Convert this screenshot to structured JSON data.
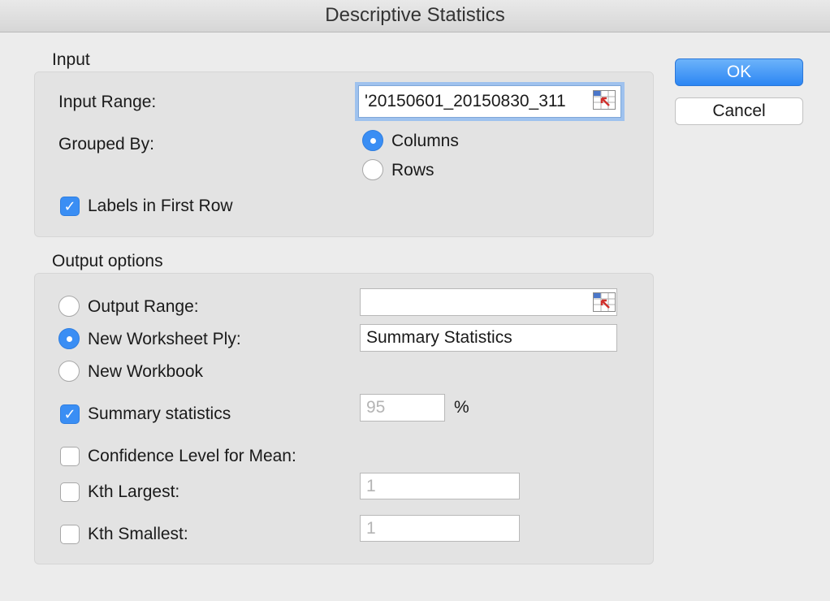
{
  "window": {
    "title": "Descriptive Statistics"
  },
  "buttons": {
    "ok": "OK",
    "cancel": "Cancel"
  },
  "input": {
    "section_label": "Input",
    "range_label": "Input Range:",
    "range_value": "'20150601_20150830_311",
    "grouped_by_label": "Grouped By:",
    "grouped_by_options": [
      "Columns",
      "Rows"
    ],
    "grouped_by_selected": "Columns",
    "labels_first_row_label": "Labels in First Row",
    "labels_first_row_checked": true
  },
  "output": {
    "section_label": "Output options",
    "options": [
      "Output Range:",
      "New Worksheet Ply:",
      "New Workbook"
    ],
    "selected": "New Worksheet Ply:",
    "output_range_value": "",
    "new_worksheet_value": "Summary Statistics",
    "summary_label": "Summary statistics",
    "summary_checked": true,
    "confidence_value": "95",
    "percent_sign": "%",
    "confidence_label": "Confidence Level for Mean:",
    "confidence_checked": false,
    "kth_largest_label": "Kth Largest:",
    "kth_largest_checked": false,
    "kth_largest_value": "1",
    "kth_smallest_label": "Kth Smallest:",
    "kth_smallest_checked": false,
    "kth_smallest_value": "1"
  },
  "icons": {
    "range_picker": "range-selector-icon",
    "check": "checkmark-icon"
  },
  "colors": {
    "accent": "#3a8ef4",
    "focus_ring": "#9fc2ee",
    "picker_arrow": "#d0312d"
  }
}
